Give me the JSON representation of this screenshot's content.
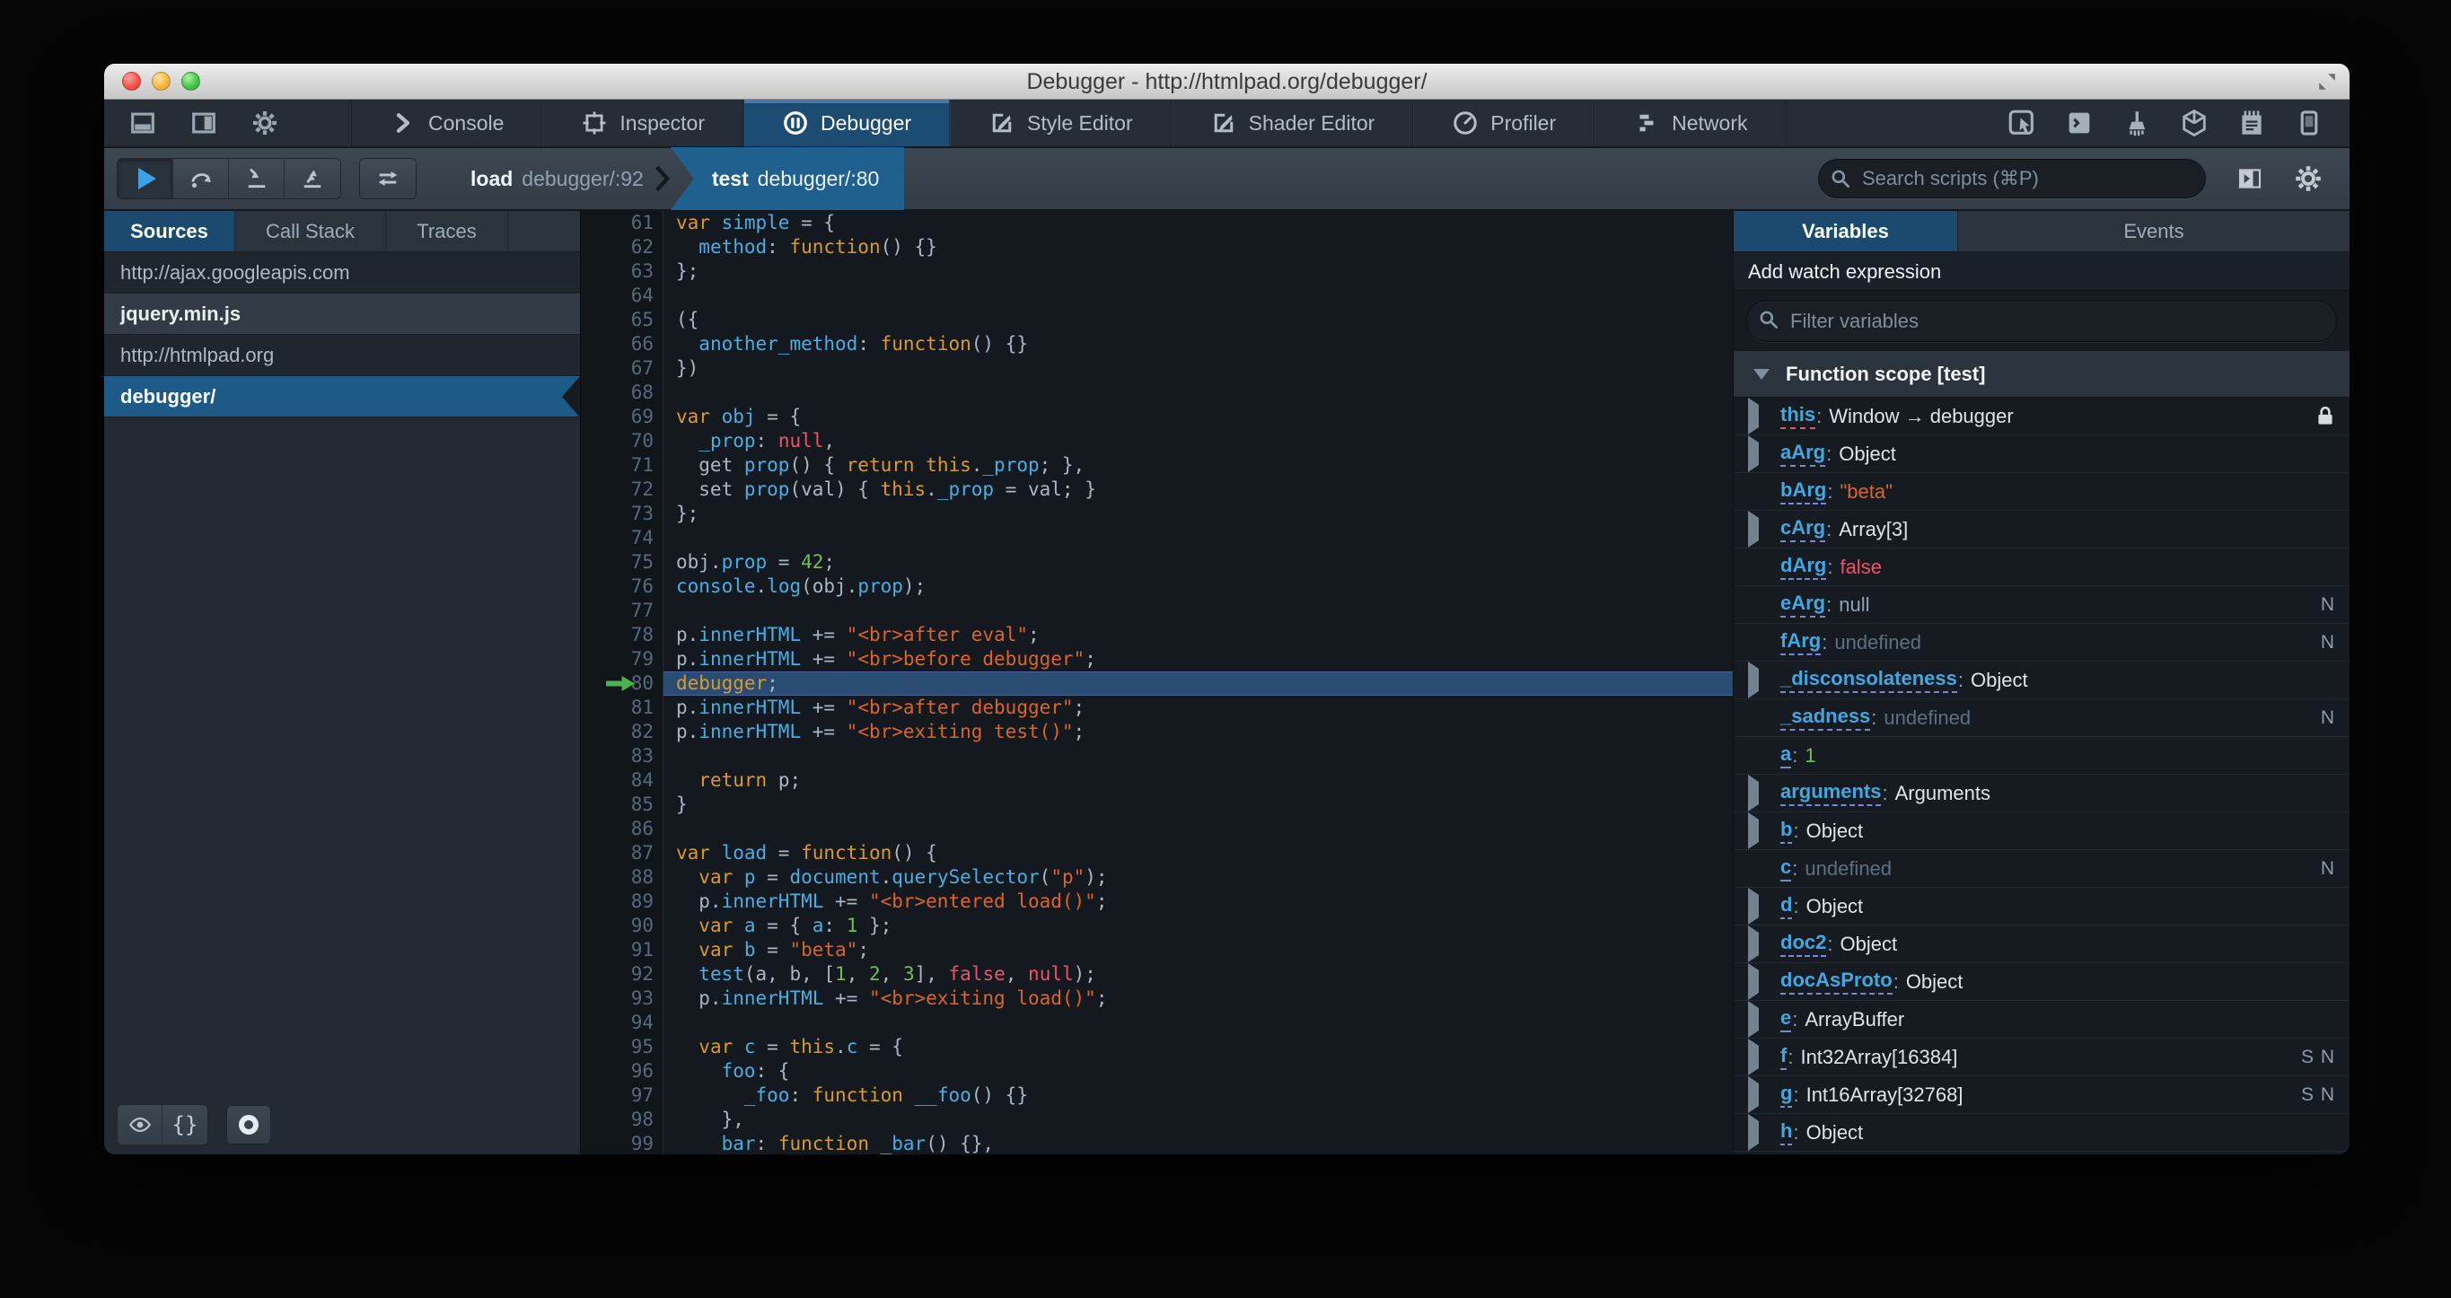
{
  "window": {
    "title": "Debugger - http://htmlpad.org/debugger/",
    "controls": [
      "close",
      "minimize",
      "zoom"
    ]
  },
  "colors": {
    "accent_blue": "#46afe3",
    "selection_blue": "#1d4c72",
    "keyword": "#d99b28",
    "string": "#d96629",
    "number": "#70bf53",
    "atom": "#eb5368",
    "highlight_line": "#2b4c72"
  },
  "toolbox": {
    "dock_buttons": [
      "dock-bottom",
      "dock-side",
      "toolbox-options"
    ],
    "tabs": [
      {
        "id": "console",
        "label": "Console",
        "active": false
      },
      {
        "id": "inspector",
        "label": "Inspector",
        "active": false
      },
      {
        "id": "debugger",
        "label": "Debugger",
        "active": true
      },
      {
        "id": "style-editor",
        "label": "Style Editor",
        "active": false
      },
      {
        "id": "shader-editor",
        "label": "Shader Editor",
        "active": false
      },
      {
        "id": "profiler",
        "label": "Profiler",
        "active": false
      },
      {
        "id": "network",
        "label": "Network",
        "active": false
      }
    ],
    "command_buttons": [
      "pick-element",
      "split-console",
      "paintbrush",
      "tilt-3d",
      "scratchpad",
      "responsive-mode"
    ]
  },
  "debugger_toolbar": {
    "step_buttons": [
      "resume",
      "step-over",
      "step-in",
      "step-out"
    ],
    "extra_button": "toggle-black-boxing",
    "breadcrumbs": [
      {
        "fn": "load",
        "location": "debugger/:92",
        "active": false
      },
      {
        "fn": "test",
        "location": "debugger/:80",
        "active": true
      }
    ],
    "search_placeholder": "Search scripts (⌘P)"
  },
  "sources_panel": {
    "tabs": [
      {
        "label": "Sources",
        "active": true
      },
      {
        "label": "Call Stack",
        "active": false
      },
      {
        "label": "Traces",
        "active": false
      }
    ],
    "items": [
      {
        "label": "http://ajax.googleapis.com",
        "type": "group",
        "selected": false
      },
      {
        "label": "jquery.min.js",
        "type": "file",
        "selected": false
      },
      {
        "label": "http://htmlpad.org",
        "type": "group",
        "selected": false
      },
      {
        "label": "debugger/",
        "type": "file",
        "selected": true
      }
    ],
    "footer_buttons": [
      "blackbox-eye",
      "pretty-print",
      "toggle-breakpoints"
    ]
  },
  "editor": {
    "first_line": 61,
    "highlighted_line": 80,
    "lines": [
      [
        [
          "k",
          "var "
        ],
        [
          "b",
          "simple"
        ],
        [
          "d",
          " = {"
        ]
      ],
      [
        [
          "d",
          "  "
        ],
        [
          "b",
          "method"
        ],
        [
          "d",
          ": "
        ],
        [
          "k",
          "function"
        ],
        [
          "d",
          "() {}"
        ]
      ],
      [
        [
          "d",
          "};"
        ]
      ],
      [],
      [
        [
          "d",
          "({"
        ]
      ],
      [
        [
          "d",
          "  "
        ],
        [
          "b",
          "another_method"
        ],
        [
          "d",
          ": "
        ],
        [
          "k",
          "function"
        ],
        [
          "d",
          "() {}"
        ]
      ],
      [
        [
          "d",
          "})"
        ]
      ],
      [],
      [
        [
          "k",
          "var "
        ],
        [
          "b",
          "obj"
        ],
        [
          "d",
          " = {"
        ]
      ],
      [
        [
          "d",
          "  "
        ],
        [
          "b",
          "_prop"
        ],
        [
          "d",
          ": "
        ],
        [
          "a",
          "null"
        ],
        [
          "d",
          ","
        ]
      ],
      [
        [
          "d",
          "  get "
        ],
        [
          "b",
          "prop"
        ],
        [
          "d",
          "() { "
        ],
        [
          "k",
          "return "
        ],
        [
          "k",
          "this"
        ],
        [
          "d",
          "."
        ],
        [
          "b",
          "_prop"
        ],
        [
          "d",
          "; },"
        ]
      ],
      [
        [
          "d",
          "  set "
        ],
        [
          "b",
          "prop"
        ],
        [
          "d",
          "(val) { "
        ],
        [
          "k",
          "this"
        ],
        [
          "d",
          "."
        ],
        [
          "b",
          "_prop"
        ],
        [
          "d",
          " = val; }"
        ]
      ],
      [
        [
          "d",
          "};"
        ]
      ],
      [],
      [
        [
          "d",
          "obj."
        ],
        [
          "b",
          "prop"
        ],
        [
          "d",
          " = "
        ],
        [
          "n",
          "42"
        ],
        [
          "d",
          ";"
        ]
      ],
      [
        [
          "b",
          "console"
        ],
        [
          "d",
          "."
        ],
        [
          "b",
          "log"
        ],
        [
          "d",
          "(obj."
        ],
        [
          "b",
          "prop"
        ],
        [
          "d",
          ");"
        ]
      ],
      [],
      [
        [
          "d",
          "p."
        ],
        [
          "b",
          "innerHTML"
        ],
        [
          "d",
          " += "
        ],
        [
          "s",
          "\"<br>after eval\""
        ],
        [
          "d",
          ";"
        ]
      ],
      [
        [
          "d",
          "p."
        ],
        [
          "b",
          "innerHTML"
        ],
        [
          "d",
          " += "
        ],
        [
          "s",
          "\"<br>before debugger\""
        ],
        [
          "d",
          ";"
        ]
      ],
      [
        [
          "k",
          "debugger"
        ],
        [
          "d",
          ";"
        ]
      ],
      [
        [
          "d",
          "p."
        ],
        [
          "b",
          "innerHTML"
        ],
        [
          "d",
          " += "
        ],
        [
          "s",
          "\"<br>after debugger\""
        ],
        [
          "d",
          ";"
        ]
      ],
      [
        [
          "d",
          "p."
        ],
        [
          "b",
          "innerHTML"
        ],
        [
          "d",
          " += "
        ],
        [
          "s",
          "\"<br>exiting test()\""
        ],
        [
          "d",
          ";"
        ]
      ],
      [],
      [
        [
          "d",
          "  "
        ],
        [
          "k",
          "return "
        ],
        [
          "d",
          "p;"
        ]
      ],
      [
        [
          "d",
          "}"
        ]
      ],
      [],
      [
        [
          "k",
          "var "
        ],
        [
          "b",
          "load"
        ],
        [
          "d",
          " = "
        ],
        [
          "k",
          "function"
        ],
        [
          "d",
          "() {"
        ]
      ],
      [
        [
          "d",
          "  "
        ],
        [
          "k",
          "var "
        ],
        [
          "b",
          "p"
        ],
        [
          "d",
          " = "
        ],
        [
          "b",
          "document"
        ],
        [
          "d",
          "."
        ],
        [
          "b",
          "querySelector"
        ],
        [
          "d",
          "("
        ],
        [
          "s",
          "\"p\""
        ],
        [
          "d",
          ");"
        ]
      ],
      [
        [
          "d",
          "  p."
        ],
        [
          "b",
          "innerHTML"
        ],
        [
          "d",
          " += "
        ],
        [
          "s",
          "\"<br>entered load()\""
        ],
        [
          "d",
          ";"
        ]
      ],
      [
        [
          "d",
          "  "
        ],
        [
          "k",
          "var "
        ],
        [
          "b",
          "a"
        ],
        [
          "d",
          " = { "
        ],
        [
          "b",
          "a"
        ],
        [
          "d",
          ": "
        ],
        [
          "n",
          "1"
        ],
        [
          "d",
          " };"
        ]
      ],
      [
        [
          "d",
          "  "
        ],
        [
          "k",
          "var "
        ],
        [
          "b",
          "b"
        ],
        [
          "d",
          " = "
        ],
        [
          "s",
          "\"beta\""
        ],
        [
          "d",
          ";"
        ]
      ],
      [
        [
          "d",
          "  "
        ],
        [
          "b",
          "test"
        ],
        [
          "d",
          "(a, b, ["
        ],
        [
          "n",
          "1"
        ],
        [
          "d",
          ", "
        ],
        [
          "n",
          "2"
        ],
        [
          "d",
          ", "
        ],
        [
          "n",
          "3"
        ],
        [
          "d",
          "], "
        ],
        [
          "a",
          "false"
        ],
        [
          "d",
          ", "
        ],
        [
          "a",
          "null"
        ],
        [
          "d",
          ");"
        ]
      ],
      [
        [
          "d",
          "  p."
        ],
        [
          "b",
          "innerHTML"
        ],
        [
          "d",
          " += "
        ],
        [
          "s",
          "\"<br>exiting load()\""
        ],
        [
          "d",
          ";"
        ]
      ],
      [],
      [
        [
          "d",
          "  "
        ],
        [
          "k",
          "var "
        ],
        [
          "b",
          "c"
        ],
        [
          "d",
          " = "
        ],
        [
          "k",
          "this"
        ],
        [
          "d",
          "."
        ],
        [
          "b",
          "c"
        ],
        [
          "d",
          " = {"
        ]
      ],
      [
        [
          "d",
          "    "
        ],
        [
          "b",
          "foo"
        ],
        [
          "d",
          ": {"
        ]
      ],
      [
        [
          "d",
          "      "
        ],
        [
          "b",
          "_foo"
        ],
        [
          "d",
          ": "
        ],
        [
          "k",
          "function "
        ],
        [
          "b",
          "__foo"
        ],
        [
          "d",
          "() {}"
        ]
      ],
      [
        [
          "d",
          "    },"
        ]
      ],
      [
        [
          "d",
          "    "
        ],
        [
          "b",
          "bar"
        ],
        [
          "d",
          ": "
        ],
        [
          "k",
          "function "
        ],
        [
          "b",
          "_bar"
        ],
        [
          "d",
          "() {},"
        ]
      ]
    ]
  },
  "variables_panel": {
    "tabs": [
      {
        "label": "Variables",
        "active": true
      },
      {
        "label": "Events",
        "active": false
      }
    ],
    "watch_label": "Add watch expression",
    "filter_placeholder": "Filter variables",
    "scope": {
      "label": "Function scope [test]",
      "expanded": true
    },
    "variables": [
      {
        "name": "this",
        "value": "Window → debugger",
        "vclass": "plain",
        "expandable": true,
        "underline": "red",
        "locked": true,
        "badges": ""
      },
      {
        "name": "aArg",
        "value": "Object",
        "vclass": "plain",
        "expandable": true,
        "badges": ""
      },
      {
        "name": "bArg",
        "value": "\"beta\"",
        "vclass": "string",
        "expandable": false,
        "badges": ""
      },
      {
        "name": "cArg",
        "value": "Array[3]",
        "vclass": "plain",
        "expandable": true,
        "badges": ""
      },
      {
        "name": "dArg",
        "value": "false",
        "vclass": "bool",
        "expandable": false,
        "badges": ""
      },
      {
        "name": "eArg",
        "value": "null",
        "vclass": "null",
        "expandable": false,
        "badges": "N"
      },
      {
        "name": "fArg",
        "value": "undefined",
        "vclass": "undef",
        "expandable": false,
        "badges": "N"
      },
      {
        "name": "_disconsolateness",
        "value": "Object",
        "vclass": "plain",
        "expandable": true,
        "badges": ""
      },
      {
        "name": "_sadness",
        "value": "undefined",
        "vclass": "undef",
        "expandable": false,
        "badges": "N"
      },
      {
        "name": "a",
        "value": "1",
        "vclass": "number",
        "expandable": false,
        "badges": ""
      },
      {
        "name": "arguments",
        "value": "Arguments",
        "vclass": "plain",
        "expandable": true,
        "badges": ""
      },
      {
        "name": "b",
        "value": "Object",
        "vclass": "plain",
        "expandable": true,
        "badges": ""
      },
      {
        "name": "c",
        "value": "undefined",
        "vclass": "undef",
        "expandable": false,
        "badges": "N"
      },
      {
        "name": "d",
        "value": "Object",
        "vclass": "plain",
        "expandable": true,
        "badges": ""
      },
      {
        "name": "doc2",
        "value": "Object",
        "vclass": "plain",
        "expandable": true,
        "badges": ""
      },
      {
        "name": "docAsProto",
        "value": "Object",
        "vclass": "plain",
        "expandable": true,
        "badges": ""
      },
      {
        "name": "e",
        "value": "ArrayBuffer",
        "vclass": "plain",
        "expandable": true,
        "badges": ""
      },
      {
        "name": "f",
        "value": "Int32Array[16384]",
        "vclass": "plain",
        "expandable": true,
        "badges": "S N"
      },
      {
        "name": "g",
        "value": "Int16Array[32768]",
        "vclass": "plain",
        "expandable": true,
        "badges": "S N"
      },
      {
        "name": "h",
        "value": "Object",
        "vclass": "plain",
        "expandable": true,
        "badges": ""
      }
    ]
  }
}
